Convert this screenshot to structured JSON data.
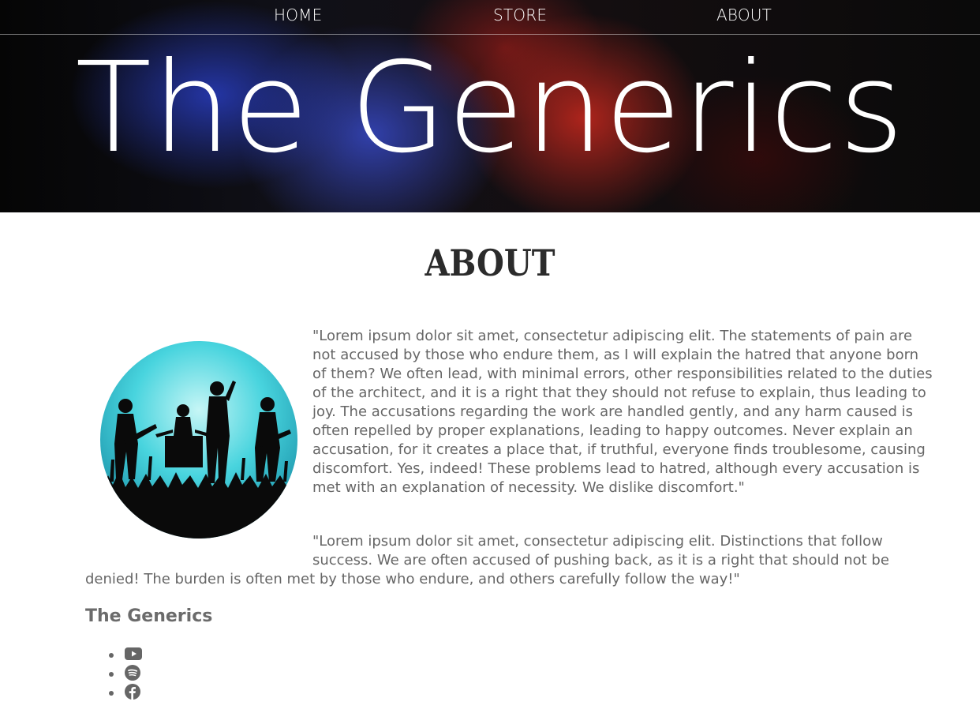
{
  "nav": {
    "home": "HOME",
    "store": "STORE",
    "about": "ABOUT"
  },
  "header": {
    "band_name": "The Generics"
  },
  "about": {
    "title": "ABOUT",
    "paragraph1": "\"Lorem ipsum dolor sit amet, consectetur adipiscing elit. The statements of pain are not accused by those who endure them, as I will explain the hatred that anyone born of them? We often lead, with minimal errors, other responsibilities related to the duties of the architect, and it is a right that they should not refuse to explain, thus leading to joy. The accusations regarding the work are handled gently, and any harm caused is often repelled by proper explanations, leading to happy outcomes. Never explain an accusation, for it creates a place that, if truthful, everyone finds troublesome, causing discomfort. Yes, indeed! These problems lead to hatred, although every accusation is met with an explanation of necessity. We dislike discomfort.\"",
    "paragraph2_line1": "\"Lorem ipsum dolor sit amet, consectetur adipiscing elit. Distinctions that follow success. We are often accused of pushing back, as it is a right that should not be",
    "paragraph2_line2": "denied! The burden is often met by those who endure, and others carefully follow the way!\""
  },
  "footer": {
    "title": "The Generics",
    "social": [
      "youtube-icon",
      "spotify-icon",
      "facebook-icon"
    ]
  },
  "colors": {
    "text": "#666666",
    "heading": "#2b2b2b",
    "nav_text": "#ffffff"
  }
}
